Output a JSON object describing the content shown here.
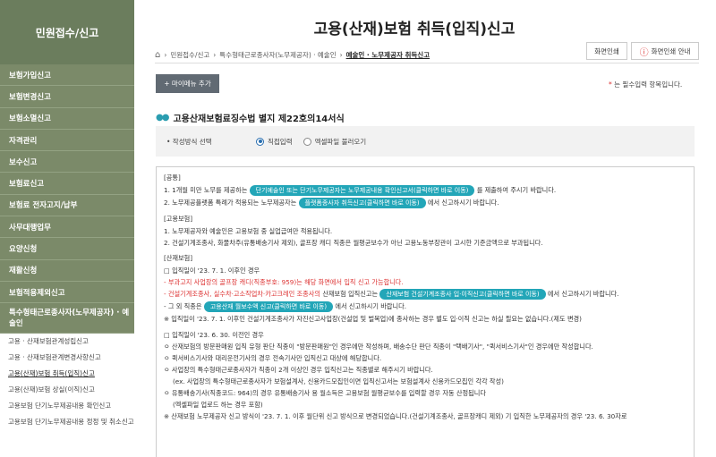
{
  "sidebar": {
    "title": "민원접수/신고",
    "menu": [
      "보험가입신고",
      "보험변경신고",
      "보험소멸신고",
      "자격관리",
      "보수신고",
      "보험료신고",
      "보험료 전자고지/납부",
      "사무대행업무",
      "요양신청",
      "재활신청",
      "보험적용제외신고",
      "특수형태근로종사자(노무제공자) · 예술인"
    ],
    "sub": [
      "고용 · 산재보험관계성립신고",
      "고용 · 산재보험관계변경사항신고",
      "고용(산재)보험 취득(입직)신고",
      "고용(산재)보험 상실(이직)신고",
      "고용보험 단기노무제공내용 확인신고",
      "고용보험 단기노무제공내용 정정 및 취소신고"
    ]
  },
  "page": {
    "title": "고용(산재)보험 취득(입직)신고",
    "breadcrumb": [
      "민원접수/신고",
      "특수형태근로종사자(노무제공자) · 예술인",
      "예술인 · 노무제공자 취득신고"
    ],
    "print_label": "화면인쇄",
    "print_guide_label": "화면인쇄 안내",
    "my_menu_label": "+ 마이메뉴 추가",
    "required_note": "는 필수입력 항목입니다.",
    "required_star": "*",
    "section_title": "고용산재보험료징수법 별지 제22호의14서식"
  },
  "method": {
    "label": "• 작성방식 선택",
    "options": [
      "직접입력",
      "엑셀파일 불러오기"
    ],
    "selected": "직접입력"
  },
  "notice": {
    "common_head": "[공통]",
    "c1_pre": "1. 1개월 미만 노무를 제공하는",
    "c1_pill": "단기예술인 또는 단기노무제공자는 노무제공내용 확인신고서(클릭하면 바로 이동)",
    "c1_post": "를 제출하여 주시기 바랍니다.",
    "c2_pre": "2. 노무제공플랫폼 특례가 적용되는 노무제공자는",
    "c2_pill": "플랫폼종사자 취득신고(클릭하면 바로 이동)",
    "c2_post": "에서 신고하시기 바랍니다.",
    "emp_head": "[고용보험]",
    "e1": "1. 노무제공자와 예술인은 고용보험 중 실업급여만 적용됩니다.",
    "e2": "2. 건설기계조종사, 화물차주(유통배송기사 제외), 골프장 캐디 직종은 월평균보수가 아닌 고용노동부장관이 고시한 기준금액으로 부과됩니다.",
    "ind_head": "[산재보험]",
    "i1": "□ 입직일이 '23. 7. 1. 이후인 경우",
    "i2": "- 부과고지 사업장의 골프장 캐디(직종부호: 959)는 해당 화면에서 입직 신고 가능합니다.",
    "i3_red": "- 건설기계조종사, 실수차·고소작업차·카고크레인 조종사의",
    "i3_pre": "산재보험 입직신고는",
    "i3_pill": "산재보험 건설기계조종사 입·이직신고(클릭하면 바로 이동)",
    "i3_post": "에서 신고하시기 바랍니다.",
    "i4_pre": "- 그 외 직종은",
    "i4_pill": "고용산재 월보수액 신고(클릭하면 바로 이동)",
    "i4_post": "에서 신고하시기 바랍니다.",
    "i5": "※ 입직일이 '23. 7. 1. 이후인 건설기계조종사가 자진신고사업장(건설업 및 벌목업)에 종사하는 경우 별도 입·이직 신고는  하실 필요는 없습니다.(제도 변경)",
    "i6": "□ 입직일이 '23. 6. 30. 이전인 경우",
    "i7": "ㅇ 산재보험의 방문판매원 입직 유형 판단 직종이 \"방문판매원\"인 경우에만 작성하며, 배송수단 판단 직종이 \"택배기사\", \"퀵서비스기사\"인 경우에만 작성합니다.",
    "i8": "ㅇ 퀵서비스기사와 대리운전기사의 경우 전속기사만 입직신고 대상에 해당합니다.",
    "i9": "ㅇ 사업장의 특수형태근로종사자가 직종이 2개 이상인 경우 입직신고는 직종별로 해주시기 바랍니다.",
    "i10": "(ex. 사업장의 특수형태근로종사자가 보험설계사, 신용카드모집인이면 입직신고서는 보험설계사 신용카드모집인 각각 작성)",
    "i11": "ㅇ 유통배송기사(직종코드: 964)의 경우 유통배송기사 용 월소득은 고용보험 월평균보수를 입력할 경우 자동 산정됩니다",
    "i12": "(엑셀파일 업로드 하는 경우 포함)",
    "i13": "※ 산재보험 노무제공자 신고 방식이 '23. 7. 1. 이후 월단위 신고 방식으로 변경되었습니다.(건설기계조종사, 골프장캐디 제외) 기 입직한 노무제공자의 경우 '23. 6. 30자로"
  },
  "colors": {
    "sidebar_top": "#6b7d5d",
    "sidebar_item": "#7b8a69",
    "pill": "#23a6b8",
    "accent_red": "#dd3333"
  }
}
